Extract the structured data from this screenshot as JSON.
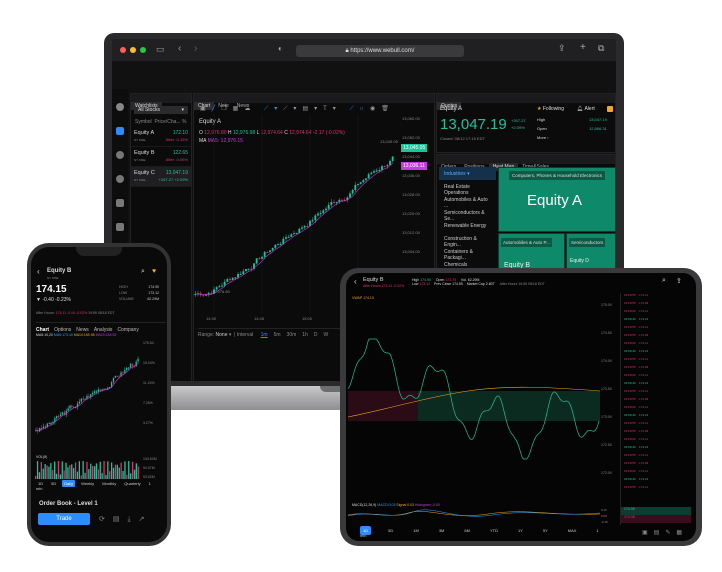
{
  "browser": {
    "url": "https://www.webull.com/"
  },
  "laptop": {
    "watchlist": {
      "tab": "Watchlists",
      "filter": "All Stocks",
      "columns": [
        "Symbol",
        "Price/Cha...",
        "%"
      ],
      "items": [
        {
          "name": "Equity A",
          "sub": "NY MSE",
          "price": "172.10",
          "change": "After -0.15%",
          "color": "#1fc39a",
          "cc": "#e0306f"
        },
        {
          "name": "Equity B",
          "sub": "NY MSE",
          "price": "122.65",
          "change": "After -0.06%",
          "color": "#1fc39a",
          "cc": "#e0306f"
        },
        {
          "name": "Equity C",
          "sub": "NY MSE",
          "price": "13,047.19",
          "change": "+267.27 +2.09%",
          "color": "#1fc39a",
          "cc": "#1fc39a"
        }
      ]
    },
    "chart": {
      "tabs": [
        "Chart",
        "Note",
        "News"
      ],
      "title": "Equity A",
      "ohlc": {
        "o_label": "O",
        "o": "12,976.80",
        "h_label": "H",
        "h": "12,976.98",
        "l_label": "L",
        "l": "12,974.64",
        "c_label": "C",
        "c": "12,974.64",
        "chg": "-2.17 (-0.02%)"
      },
      "ma": {
        "label": "MA",
        "value": "MA5: 12,976.15"
      },
      "high_marker": "13,045.05",
      "low_marker": "12,976.80",
      "y_ticks": [
        "13,060.00",
        "13,052.00",
        "13,044.00",
        "13,036.00",
        "13,028.00",
        "13,020.00",
        "13,012.00",
        "13,004.00",
        "12,996.00",
        "12,988.00"
      ],
      "x_ticks": [
        "14:30",
        "14:45",
        "15:00",
        "15:15",
        "15:30"
      ],
      "last_price": "13,045.05",
      "ma_price": "13,036.11",
      "range_label": "Range:",
      "range_value": "None",
      "interval_label": "Interval",
      "intervals": [
        "1m",
        "5m",
        "30m",
        "1h",
        "D",
        "W"
      ],
      "active_interval": "1m"
    },
    "quotes": {
      "tab": "Quotes",
      "symbol": "Equity A",
      "following": "Following",
      "alert": "Alert",
      "price": "13,047.19",
      "change": "+267.27",
      "change_pct": "+2.09%",
      "status": "Closed: 08/12 17:15 EDT",
      "high_label": "High",
      "high": "13,047.19",
      "open_label": "Open",
      "open": "12,866.31",
      "more": "More"
    },
    "heatmap": {
      "tabs": [
        "Orders",
        "Positions",
        "Heat Map",
        "Time&Sales"
      ],
      "active": "Heat Map",
      "dropdown": "Industries",
      "industries": [
        "Real Estate Operations",
        "Automobiles & Auto ...",
        "Semiconductors & Se...",
        "Renewable Energy",
        "Construction & Engin...",
        "Containers & Packagi...",
        "Chemicals"
      ],
      "big_label": "Computers, Phones & Household Electronics",
      "big_name": "Equity A",
      "b_label": "Automobiles & Auto P...",
      "b_name": "Equity B",
      "c_label": "Semiconductors",
      "d_name": "Equity D"
    }
  },
  "phone": {
    "symbol": "Equity B",
    "exchange": "NY MSE",
    "price": "174.15",
    "change": "-0.40 -0.23%",
    "stats": [
      {
        "k": "HIGH",
        "v": "174.90"
      },
      {
        "k": "LOW",
        "v": "173.12"
      },
      {
        "k": "VOLUME",
        "v": "62.29M"
      }
    ],
    "after_hours": "After Hours:",
    "after_value": "174.11 -0.04 -0.02%",
    "after_time": "19:59 08/18 EDT",
    "tabs": [
      "Chart",
      "Options",
      "News",
      "Analysis",
      "Company"
    ],
    "ma_line": "MA5:10,20",
    "ma5": "MA5:173.40",
    "ma10": "MA10:169.98",
    "ma20": "MA20:164.52",
    "y_ticks": [
      "175.54",
      "15.04%",
      "11.15%",
      "7.26%",
      "3.27%"
    ],
    "vol_label": "VOL(5)",
    "vol_ticks": [
      "134.52M",
      "94.07M",
      "53.62M"
    ],
    "periods": [
      "1D",
      "5D",
      "Daily",
      "Weekly",
      "Monthly",
      "Quarterly",
      "1 min"
    ],
    "active_period": "Daily",
    "order_book": "Order Book - Level 1",
    "trade": "Trade"
  },
  "tablet": {
    "symbol": "Equity B",
    "after": "After Hours 174.11 -0.02%",
    "high_label": "High",
    "high": "174.90",
    "low_label": "Low",
    "low": "173.12",
    "open_label": "Open",
    "open": "173.75",
    "prev_label": "Prev Close",
    "prev": "174.55",
    "vol_label": "Vol.",
    "vol": "62.29M",
    "cap_label": "Market Cap",
    "cap": "2.80T",
    "after_hours": "After Hours 19:59 08/18 EDT",
    "vwap": "VWAP 174.13",
    "y_ticks": [
      "175.00",
      "174.50",
      "174.00",
      "173.50",
      "173.00",
      "172.50",
      "172.00"
    ],
    "macd_label": "MACD(12,26,9)",
    "macd": "MACD:0.03",
    "signal": "Signal:0.03",
    "hist": "Histogram:-0.00",
    "macd_ticks": [
      "0.15",
      "0.00",
      "-0.15"
    ],
    "trades": [
      {
        "t": "19:59:55",
        "p": "174.11",
        "c": "r"
      },
      {
        "t": "19:59:55",
        "p": "174.09",
        "c": "r"
      },
      {
        "t": "19:59:52",
        "p": "174.11",
        "c": "r"
      },
      {
        "t": "19:59:40",
        "p": "174.13",
        "c": "g"
      }
    ],
    "book": [
      {
        "p": "174.06",
        "c": "g"
      },
      {
        "p": "174.08",
        "c": "r"
      }
    ],
    "periods": [
      "1D",
      "5D",
      "1M",
      "3M",
      "6M",
      "YTD",
      "1Y",
      "5Y",
      "MAX",
      "1 min"
    ],
    "active_period": "1D"
  },
  "colors": {
    "up": "#1fc39a",
    "down": "#e0306f",
    "accent": "#2fa3ff",
    "ma": "#c23ee0"
  }
}
